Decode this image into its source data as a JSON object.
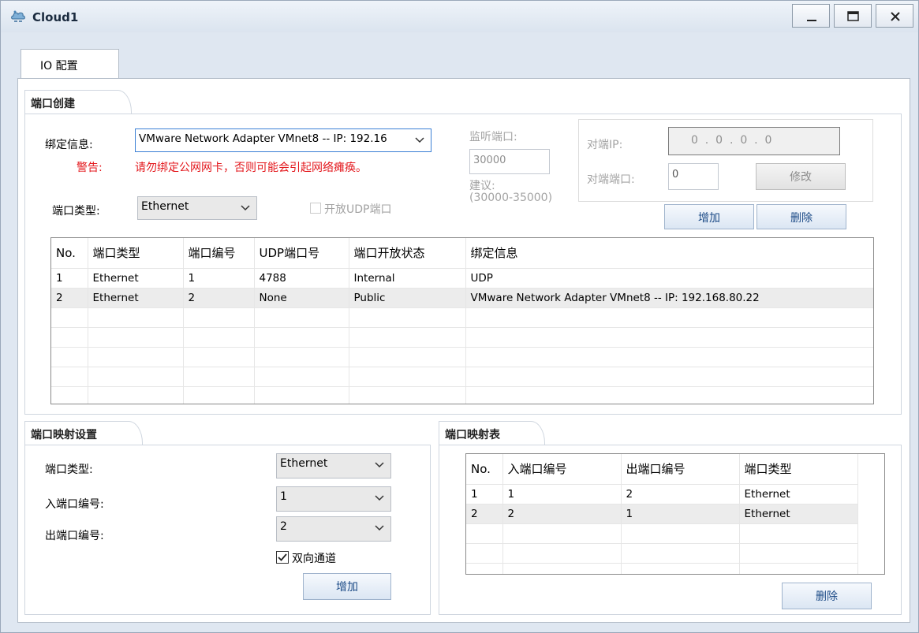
{
  "window": {
    "title": "Cloud1",
    "minimize": "minimize",
    "maximize": "maximize",
    "close": "close"
  },
  "tabs": [
    {
      "label": "IO 配置"
    }
  ],
  "port_create": {
    "group_label": "端口创建",
    "bind_label": "绑定信息:",
    "bind_value": "VMware Network Adapter VMnet8 -- IP: 192.16",
    "warning_label": "警告:",
    "warning_text": "请勿绑定公网网卡，否则可能会引起网络瘫痪。",
    "port_type_label": "端口类型:",
    "port_type_value": "Ethernet",
    "udp_open_label": "开放UDP端口",
    "listen_port_label": "监听端口:",
    "listen_port_value": "30000",
    "suggest_label": "建议:",
    "suggest_range": "(30000-35000)",
    "peer_ip_label": "对端IP:",
    "peer_ip_value": "0  .  0  .  0  .  0",
    "peer_port_label": "对端端口:",
    "peer_port_value": "0",
    "modify_label": "修改",
    "add_label": "增加",
    "delete_label": "删除"
  },
  "port_table": {
    "headers": [
      "No.",
      "端口类型",
      "端口编号",
      "UDP端口号",
      "端口开放状态",
      "绑定信息"
    ],
    "rows": [
      [
        "1",
        "Ethernet",
        "1",
        "4788",
        "Internal",
        "UDP"
      ],
      [
        "2",
        "Ethernet",
        "2",
        "None",
        "Public",
        "VMware Network Adapter VMnet8 -- IP: 192.168.80.22"
      ]
    ]
  },
  "mapping_settings": {
    "group_label": "端口映射设置",
    "port_type_label": "端口类型:",
    "port_type_value": "Ethernet",
    "in_port_label": "入端口编号:",
    "in_port_value": "1",
    "out_port_label": "出端口编号:",
    "out_port_value": "2",
    "bidirectional_label": "双向通道",
    "add_label": "增加"
  },
  "mapping_table": {
    "group_label": "端口映射表",
    "headers": [
      "No.",
      "入端口编号",
      "出端口编号",
      "端口类型"
    ],
    "rows": [
      [
        "1",
        "1",
        "2",
        "Ethernet"
      ],
      [
        "2",
        "2",
        "1",
        "Ethernet"
      ]
    ],
    "delete_label": "删除"
  }
}
